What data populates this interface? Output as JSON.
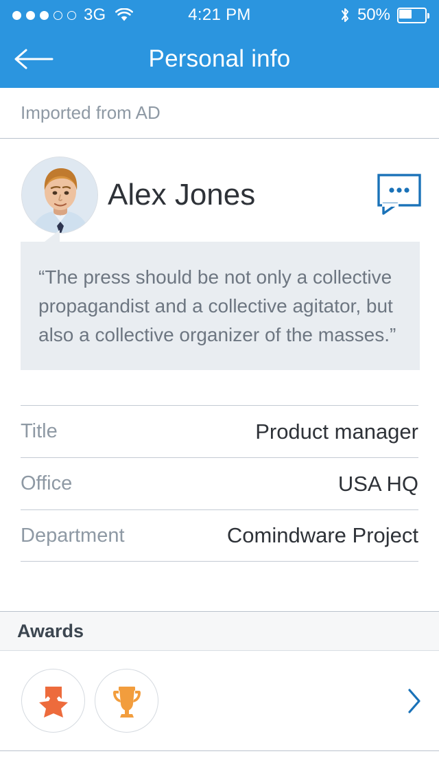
{
  "status_bar": {
    "signal_dots_filled": 3,
    "signal_dots_total": 5,
    "carrier": "3G",
    "wifi_icon": "wifi-icon",
    "time": "4:21 PM",
    "bluetooth_icon": "bluetooth-icon",
    "battery_percent": "50%",
    "battery_level": 50
  },
  "nav": {
    "back_icon": "back-arrow-icon",
    "title": "Personal info"
  },
  "source": {
    "label": "Imported from AD"
  },
  "profile": {
    "avatar_alt": "Alex Jones profile photo",
    "name": "Alex Jones",
    "comment_icon": "comment-bubble-icon",
    "quote": "“The press should be not only a collective propagandist and a collective agitator, but also a collective organizer of the masses.”"
  },
  "info_rows": [
    {
      "label": "Title",
      "value": "Product manager"
    },
    {
      "label": "Office",
      "value": "USA HQ"
    },
    {
      "label": "Department",
      "value": "Comindware Project"
    }
  ],
  "awards": {
    "title": "Awards",
    "items": [
      {
        "icon": "star-ribbon-medal-icon",
        "color": "#ED6B3C"
      },
      {
        "icon": "trophy-icon",
        "color": "#F29D3D"
      }
    ],
    "disclosure_icon": "chevron-right-icon"
  },
  "colors": {
    "header_blue": "#2B95DF",
    "accent_blue": "#1A72B8",
    "quote_bg": "#E9EDF1",
    "label_gray": "#8E99A4",
    "value_dark": "#2E3238"
  }
}
